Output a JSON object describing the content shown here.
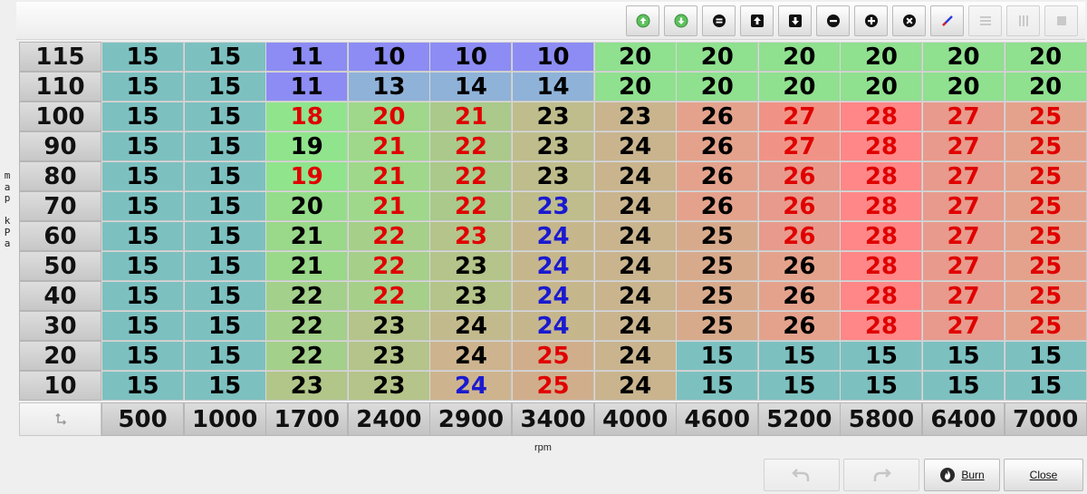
{
  "toolbar": {
    "buttons": [
      {
        "name": "increment-green-icon"
      },
      {
        "name": "decrement-green-icon"
      },
      {
        "name": "equals-icon"
      },
      {
        "name": "arrow-up-icon"
      },
      {
        "name": "arrow-down-icon"
      },
      {
        "name": "minus-icon"
      },
      {
        "name": "plus-icon"
      },
      {
        "name": "cross-icon"
      },
      {
        "name": "pen-icon"
      },
      {
        "name": "rows-icon"
      },
      {
        "name": "columns-icon"
      },
      {
        "name": "fill-icon"
      }
    ]
  },
  "y_axis": {
    "label_chars": [
      "m",
      "a",
      "p",
      "",
      "k",
      "P",
      "a"
    ],
    "values": [
      "115",
      "110",
      "100",
      "90",
      "80",
      "70",
      "60",
      "50",
      "40",
      "30",
      "20",
      "10"
    ]
  },
  "x_axis": {
    "label": "rpm",
    "values": [
      "500",
      "1000",
      "1700",
      "2400",
      "2900",
      "3400",
      "4000",
      "4600",
      "5200",
      "5800",
      "6400",
      "7000"
    ]
  },
  "table": {
    "rows": [
      [
        "15",
        "15",
        "11",
        "10",
        "10",
        "10",
        "20",
        "20",
        "20",
        "20",
        "20",
        "20"
      ],
      [
        "15",
        "15",
        "11",
        "13",
        "14",
        "14",
        "20",
        "20",
        "20",
        "20",
        "20",
        "20"
      ],
      [
        "15",
        "15",
        "18",
        "20",
        "21",
        "23",
        "23",
        "26",
        "27",
        "28",
        "27",
        "25"
      ],
      [
        "15",
        "15",
        "19",
        "21",
        "22",
        "23",
        "24",
        "26",
        "27",
        "28",
        "27",
        "25"
      ],
      [
        "15",
        "15",
        "19",
        "21",
        "22",
        "23",
        "24",
        "26",
        "26",
        "28",
        "27",
        "25"
      ],
      [
        "15",
        "15",
        "20",
        "21",
        "22",
        "23",
        "24",
        "26",
        "26",
        "28",
        "27",
        "25"
      ],
      [
        "15",
        "15",
        "21",
        "22",
        "23",
        "24",
        "24",
        "25",
        "26",
        "28",
        "27",
        "25"
      ],
      [
        "15",
        "15",
        "21",
        "22",
        "23",
        "24",
        "24",
        "25",
        "26",
        "28",
        "27",
        "25"
      ],
      [
        "15",
        "15",
        "22",
        "22",
        "23",
        "24",
        "24",
        "25",
        "26",
        "28",
        "27",
        "25"
      ],
      [
        "15",
        "15",
        "22",
        "23",
        "24",
        "24",
        "24",
        "25",
        "26",
        "28",
        "27",
        "25"
      ],
      [
        "15",
        "15",
        "22",
        "23",
        "24",
        "25",
        "24",
        "15",
        "15",
        "15",
        "15",
        "15"
      ],
      [
        "15",
        "15",
        "23",
        "23",
        "24",
        "25",
        "24",
        "15",
        "15",
        "15",
        "15",
        "15"
      ]
    ],
    "bg": [
      [
        "#7dc0c0",
        "#7dc0c0",
        "#8c8cf4",
        "#8c8cf4",
        "#8c8cf4",
        "#8c8cf4",
        "#8fe08f",
        "#8fe08f",
        "#8fe08f",
        "#8fe08f",
        "#8fe08f",
        "#8fe08f"
      ],
      [
        "#7dc0c0",
        "#7dc0c0",
        "#8c8cf4",
        "#8fb2d8",
        "#8fb2d8",
        "#8fb2d8",
        "#8fe08f",
        "#8fe08f",
        "#8fe08f",
        "#8fe08f",
        "#8fe08f",
        "#8fe08f"
      ],
      [
        "#7dc0c0",
        "#7dc0c0",
        "#90e48c",
        "#9fd88a",
        "#aac98a",
        "#bfbd8c",
        "#c9b48e",
        "#e4a28c",
        "#f09386",
        "#ff8787",
        "#e89a8c",
        "#e4a28c"
      ],
      [
        "#7dc0c0",
        "#7dc0c0",
        "#90e48c",
        "#9fd88a",
        "#aac98a",
        "#bfbd8c",
        "#c9b48e",
        "#e4a28c",
        "#f09386",
        "#ff8787",
        "#e89a8c",
        "#e4a28c"
      ],
      [
        "#7dc0c0",
        "#7dc0c0",
        "#90e48c",
        "#9fd88a",
        "#aac98a",
        "#bfbd8c",
        "#c9b48e",
        "#e4a28c",
        "#e89a8c",
        "#ff8787",
        "#e89a8c",
        "#e4a28c"
      ],
      [
        "#7dc0c0",
        "#7dc0c0",
        "#95dd8a",
        "#9fd88a",
        "#aac98a",
        "#bfbd8c",
        "#c9b48e",
        "#e4a28c",
        "#e89a8c",
        "#ff8787",
        "#e89a8c",
        "#e4a28c"
      ],
      [
        "#7dc0c0",
        "#7dc0c0",
        "#9ad88a",
        "#a6cf8a",
        "#b4c48a",
        "#c6b68c",
        "#c9b48e",
        "#d8aa8c",
        "#e89a8c",
        "#ff8787",
        "#e89a8c",
        "#e4a28c"
      ],
      [
        "#7dc0c0",
        "#7dc0c0",
        "#9ad88a",
        "#a6cf8a",
        "#b4c48a",
        "#c6b68c",
        "#c9b48e",
        "#d8aa8c",
        "#e4a28c",
        "#ff8787",
        "#e89a8c",
        "#e4a28c"
      ],
      [
        "#7dc0c0",
        "#7dc0c0",
        "#a3d08a",
        "#a6cf8a",
        "#b4c48a",
        "#c6b68c",
        "#c9b48e",
        "#d8aa8c",
        "#e4a28c",
        "#ff8787",
        "#e89a8c",
        "#e4a28c"
      ],
      [
        "#7dc0c0",
        "#7dc0c0",
        "#a3d08a",
        "#b4c48a",
        "#c2ba8c",
        "#c6b68c",
        "#c9b48e",
        "#d8aa8c",
        "#e4a28c",
        "#ff8787",
        "#e89a8c",
        "#e4a28c"
      ],
      [
        "#7dc0c0",
        "#7dc0c0",
        "#a3d08a",
        "#b4c48a",
        "#cdb48e",
        "#d0ae8c",
        "#c9b48e",
        "#7dc0c0",
        "#7dc0c0",
        "#7dc0c0",
        "#7dc0c0",
        "#7dc0c0"
      ],
      [
        "#7dc0c0",
        "#7dc0c0",
        "#b2c68a",
        "#b4c48a",
        "#cdb48e",
        "#d0ae8c",
        "#c9b48e",
        "#7dc0c0",
        "#7dc0c0",
        "#7dc0c0",
        "#7dc0c0",
        "#7dc0c0"
      ]
    ],
    "fg": [
      [
        "#000000",
        "#000000",
        "#000000",
        "#000000",
        "#000000",
        "#000000",
        "#000000",
        "#000000",
        "#000000",
        "#000000",
        "#000000",
        "#000000"
      ],
      [
        "#000000",
        "#000000",
        "#000000",
        "#000000",
        "#000000",
        "#000000",
        "#000000",
        "#000000",
        "#000000",
        "#000000",
        "#000000",
        "#000000"
      ],
      [
        "#000000",
        "#000000",
        "#e00000",
        "#e00000",
        "#e00000",
        "#000000",
        "#000000",
        "#000000",
        "#e00000",
        "#e00000",
        "#e00000",
        "#e00000"
      ],
      [
        "#000000",
        "#000000",
        "#000000",
        "#e00000",
        "#e00000",
        "#000000",
        "#000000",
        "#000000",
        "#e00000",
        "#e00000",
        "#e00000",
        "#e00000"
      ],
      [
        "#000000",
        "#000000",
        "#e00000",
        "#e00000",
        "#e00000",
        "#000000",
        "#000000",
        "#000000",
        "#e00000",
        "#e00000",
        "#e00000",
        "#e00000"
      ],
      [
        "#000000",
        "#000000",
        "#000000",
        "#e00000",
        "#e00000",
        "#1a1ad0",
        "#000000",
        "#000000",
        "#e00000",
        "#e00000",
        "#e00000",
        "#e00000"
      ],
      [
        "#000000",
        "#000000",
        "#000000",
        "#e00000",
        "#e00000",
        "#1a1ad0",
        "#000000",
        "#000000",
        "#e00000",
        "#e00000",
        "#e00000",
        "#e00000"
      ],
      [
        "#000000",
        "#000000",
        "#000000",
        "#e00000",
        "#000000",
        "#1a1ad0",
        "#000000",
        "#000000",
        "#000000",
        "#e00000",
        "#e00000",
        "#e00000"
      ],
      [
        "#000000",
        "#000000",
        "#000000",
        "#e00000",
        "#000000",
        "#1a1ad0",
        "#000000",
        "#000000",
        "#000000",
        "#e00000",
        "#e00000",
        "#e00000"
      ],
      [
        "#000000",
        "#000000",
        "#000000",
        "#000000",
        "#000000",
        "#1a1ad0",
        "#000000",
        "#000000",
        "#000000",
        "#e00000",
        "#e00000",
        "#e00000"
      ],
      [
        "#000000",
        "#000000",
        "#000000",
        "#000000",
        "#000000",
        "#e00000",
        "#000000",
        "#000000",
        "#000000",
        "#000000",
        "#000000",
        "#000000"
      ],
      [
        "#000000",
        "#000000",
        "#000000",
        "#000000",
        "#1a1ad0",
        "#e00000",
        "#000000",
        "#000000",
        "#000000",
        "#000000",
        "#000000",
        "#000000"
      ]
    ]
  },
  "footer": {
    "burn_label": "Burn",
    "close_label": "Close"
  }
}
